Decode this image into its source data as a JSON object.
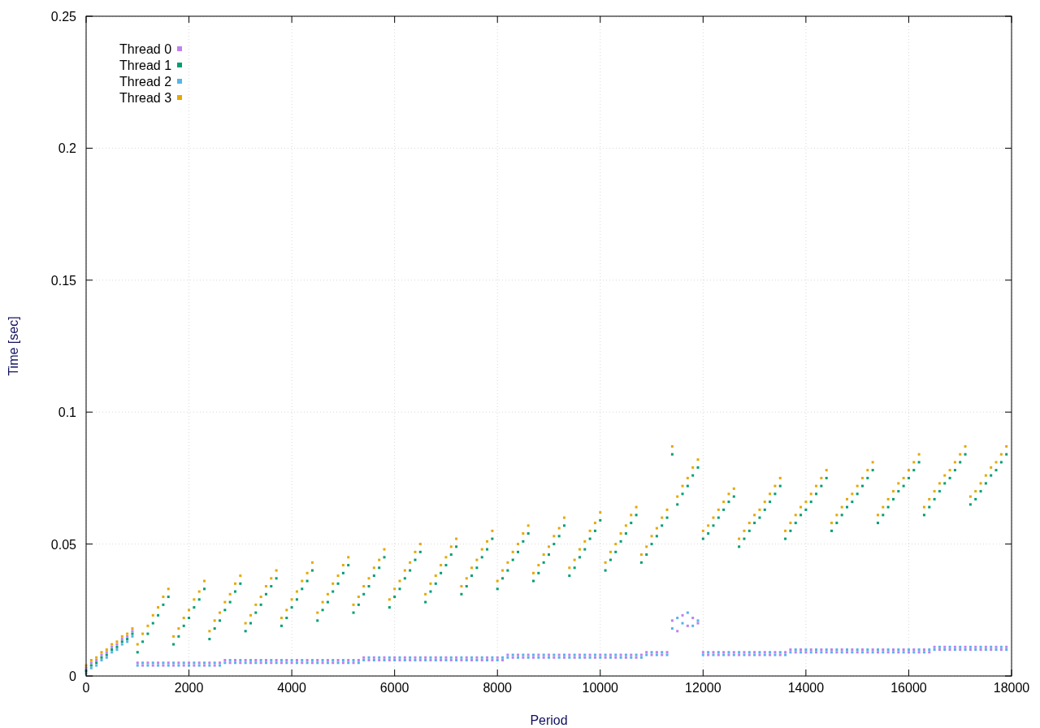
{
  "chart_data": {
    "type": "scatter",
    "xlabel": "Period",
    "ylabel": "Time [sec]",
    "xlim": [
      0,
      18000
    ],
    "ylim": [
      0,
      0.25
    ],
    "grid": true,
    "legend": true,
    "x": [
      0,
      100,
      200,
      300,
      400,
      500,
      600,
      700,
      800,
      900,
      1000,
      1100,
      1200,
      1300,
      1400,
      1500,
      1600,
      1700,
      1800,
      1900,
      2000,
      2100,
      2200,
      2300,
      2400,
      2500,
      2600,
      2700,
      2800,
      2900,
      3000,
      3100,
      3200,
      3300,
      3400,
      3500,
      3600,
      3700,
      3800,
      3900,
      4000,
      4100,
      4200,
      4300,
      4400,
      4500,
      4600,
      4700,
      4800,
      4900,
      5000,
      5100,
      5200,
      5300,
      5400,
      5500,
      5600,
      5700,
      5800,
      5900,
      6000,
      6100,
      6200,
      6300,
      6400,
      6500,
      6600,
      6700,
      6800,
      6900,
      7000,
      7100,
      7200,
      7300,
      7400,
      7500,
      7600,
      7700,
      7800,
      7900,
      8000,
      8100,
      8200,
      8300,
      8400,
      8500,
      8600,
      8700,
      8800,
      8900,
      9000,
      9100,
      9200,
      9300,
      9400,
      9500,
      9600,
      9700,
      9800,
      9900,
      10000,
      10100,
      10200,
      10300,
      10400,
      10500,
      10600,
      10700,
      10800,
      10900,
      11000,
      11100,
      11200,
      11300,
      11400,
      11500,
      11600,
      11700,
      11800,
      11900,
      12000,
      12100,
      12200,
      12300,
      12400,
      12500,
      12600,
      12700,
      12800,
      12900,
      13000,
      13100,
      13200,
      13300,
      13400,
      13500,
      13600,
      13700,
      13800,
      13900,
      14000,
      14100,
      14200,
      14300,
      14400,
      14500,
      14600,
      14700,
      14800,
      14900,
      15000,
      15100,
      15200,
      15300,
      15400,
      15500,
      15600,
      15700,
      15800,
      15900,
      16000,
      16100,
      16200,
      16300,
      16400,
      16500,
      16600,
      16700,
      16800,
      16900,
      17000,
      17100,
      17200,
      17300,
      17400,
      17500,
      17600,
      17700,
      17800,
      17900
    ],
    "xticks": [
      {
        "value": 0,
        "label": "0"
      },
      {
        "value": 2000,
        "label": "2000"
      },
      {
        "value": 4000,
        "label": "4000"
      },
      {
        "value": 6000,
        "label": "6000"
      },
      {
        "value": 8000,
        "label": "8000"
      },
      {
        "value": 10000,
        "label": "10000"
      },
      {
        "value": 12000,
        "label": "12000"
      },
      {
        "value": 14000,
        "label": "14000"
      },
      {
        "value": 16000,
        "label": "16000"
      },
      {
        "value": 18000,
        "label": "18000"
      }
    ],
    "yticks": [
      {
        "value": 0,
        "label": "0"
      },
      {
        "value": 0.05,
        "label": "0.05"
      },
      {
        "value": 0.1,
        "label": "0.1"
      },
      {
        "value": 0.15,
        "label": "0.15"
      },
      {
        "value": 0.2,
        "label": "0.2"
      },
      {
        "value": 0.25,
        "label": "0.25"
      }
    ],
    "series": [
      {
        "name": "Thread 0",
        "color": "#c080f0",
        "values": [
          0.003,
          0.005,
          0.006,
          0.008,
          0.009,
          0.011,
          0.012,
          0.014,
          0.015,
          0.017,
          0.005,
          0.004,
          0.005,
          0.004,
          0.005,
          0.004,
          0.005,
          0.004,
          0.005,
          0.004,
          0.005,
          0.004,
          0.005,
          0.004,
          0.005,
          0.004,
          0.005,
          0.006,
          0.005,
          0.006,
          0.005,
          0.006,
          0.005,
          0.006,
          0.005,
          0.006,
          0.005,
          0.006,
          0.005,
          0.006,
          0.005,
          0.006,
          0.005,
          0.006,
          0.005,
          0.006,
          0.005,
          0.006,
          0.005,
          0.006,
          0.005,
          0.006,
          0.005,
          0.006,
          0.007,
          0.006,
          0.007,
          0.006,
          0.007,
          0.006,
          0.007,
          0.006,
          0.007,
          0.006,
          0.007,
          0.006,
          0.007,
          0.006,
          0.007,
          0.006,
          0.007,
          0.006,
          0.007,
          0.006,
          0.007,
          0.006,
          0.007,
          0.006,
          0.007,
          0.006,
          0.007,
          0.006,
          0.008,
          0.007,
          0.008,
          0.007,
          0.008,
          0.007,
          0.008,
          0.007,
          0.008,
          0.007,
          0.008,
          0.007,
          0.008,
          0.007,
          0.008,
          0.007,
          0.008,
          0.007,
          0.008,
          0.007,
          0.008,
          0.007,
          0.008,
          0.007,
          0.008,
          0.007,
          0.008,
          0.009,
          0.008,
          0.009,
          0.008,
          0.009,
          0.021,
          0.017,
          0.023,
          0.019,
          0.022,
          0.02,
          0.009,
          0.008,
          0.009,
          0.008,
          0.009,
          0.008,
          0.009,
          0.008,
          0.009,
          0.008,
          0.009,
          0.008,
          0.009,
          0.008,
          0.009,
          0.008,
          0.009,
          0.01,
          0.009,
          0.01,
          0.009,
          0.01,
          0.009,
          0.01,
          0.009,
          0.01,
          0.009,
          0.01,
          0.009,
          0.01,
          0.009,
          0.01,
          0.009,
          0.01,
          0.009,
          0.01,
          0.009,
          0.01,
          0.009,
          0.01,
          0.009,
          0.01,
          0.009,
          0.01,
          0.009,
          0.011,
          0.01,
          0.011,
          0.01,
          0.011,
          0.01,
          0.011,
          0.01,
          0.011,
          0.01,
          0.011,
          0.01,
          0.011,
          0.01,
          0.011
        ]
      },
      {
        "name": "Thread 1",
        "color": "#009e73",
        "values": [
          0.002,
          0.004,
          0.005,
          0.007,
          0.008,
          0.01,
          0.011,
          0.013,
          0.014,
          0.016,
          0.009,
          0.013,
          0.016,
          0.02,
          0.023,
          0.027,
          0.03,
          0.012,
          0.015,
          0.019,
          0.022,
          0.026,
          0.029,
          0.033,
          0.014,
          0.018,
          0.021,
          0.025,
          0.028,
          0.032,
          0.035,
          0.017,
          0.02,
          0.024,
          0.027,
          0.031,
          0.034,
          0.037,
          0.019,
          0.022,
          0.026,
          0.029,
          0.033,
          0.036,
          0.04,
          0.021,
          0.025,
          0.028,
          0.032,
          0.035,
          0.039,
          0.042,
          0.024,
          0.027,
          0.031,
          0.034,
          0.038,
          0.041,
          0.045,
          0.026,
          0.03,
          0.033,
          0.037,
          0.04,
          0.044,
          0.047,
          0.028,
          0.032,
          0.035,
          0.039,
          0.042,
          0.046,
          0.049,
          0.031,
          0.034,
          0.038,
          0.041,
          0.045,
          0.048,
          0.052,
          0.033,
          0.037,
          0.04,
          0.044,
          0.047,
          0.051,
          0.054,
          0.036,
          0.039,
          0.043,
          0.046,
          0.05,
          0.053,
          0.057,
          0.038,
          0.041,
          0.045,
          0.048,
          0.052,
          0.055,
          0.059,
          0.04,
          0.044,
          0.047,
          0.051,
          0.054,
          0.058,
          0.061,
          0.043,
          0.046,
          0.05,
          0.053,
          0.057,
          0.06,
          0.084,
          0.065,
          0.069,
          0.072,
          0.076,
          0.079,
          0.052,
          0.054,
          0.057,
          0.06,
          0.063,
          0.066,
          0.068,
          0.049,
          0.052,
          0.055,
          0.058,
          0.06,
          0.063,
          0.066,
          0.069,
          0.072,
          0.052,
          0.055,
          0.058,
          0.061,
          0.063,
          0.066,
          0.069,
          0.072,
          0.075,
          0.055,
          0.058,
          0.061,
          0.064,
          0.066,
          0.069,
          0.072,
          0.075,
          0.078,
          0.058,
          0.061,
          0.064,
          0.067,
          0.07,
          0.072,
          0.075,
          0.078,
          0.081,
          0.061,
          0.064,
          0.067,
          0.07,
          0.073,
          0.075,
          0.078,
          0.081,
          0.084,
          0.065,
          0.067,
          0.07,
          0.073,
          0.076,
          0.078,
          0.081,
          0.084
        ]
      },
      {
        "name": "Thread 2",
        "color": "#56b4e9",
        "values": [
          0.001,
          0.003,
          0.004,
          0.006,
          0.007,
          0.009,
          0.01,
          0.012,
          0.013,
          0.015,
          0.004,
          0.005,
          0.004,
          0.005,
          0.004,
          0.005,
          0.004,
          0.005,
          0.004,
          0.005,
          0.004,
          0.005,
          0.004,
          0.005,
          0.004,
          0.005,
          0.004,
          0.005,
          0.006,
          0.005,
          0.006,
          0.005,
          0.006,
          0.005,
          0.006,
          0.005,
          0.006,
          0.005,
          0.006,
          0.005,
          0.006,
          0.005,
          0.006,
          0.005,
          0.006,
          0.005,
          0.006,
          0.005,
          0.006,
          0.005,
          0.006,
          0.005,
          0.006,
          0.005,
          0.006,
          0.007,
          0.006,
          0.007,
          0.006,
          0.007,
          0.006,
          0.007,
          0.006,
          0.007,
          0.006,
          0.007,
          0.006,
          0.007,
          0.006,
          0.007,
          0.006,
          0.007,
          0.006,
          0.007,
          0.006,
          0.007,
          0.006,
          0.007,
          0.006,
          0.007,
          0.006,
          0.007,
          0.007,
          0.008,
          0.007,
          0.008,
          0.007,
          0.008,
          0.007,
          0.008,
          0.007,
          0.008,
          0.007,
          0.008,
          0.007,
          0.008,
          0.007,
          0.008,
          0.007,
          0.008,
          0.007,
          0.008,
          0.007,
          0.008,
          0.007,
          0.008,
          0.007,
          0.008,
          0.007,
          0.008,
          0.009,
          0.008,
          0.009,
          0.008,
          0.018,
          0.022,
          0.02,
          0.024,
          0.019,
          0.021,
          0.008,
          0.009,
          0.008,
          0.009,
          0.008,
          0.009,
          0.008,
          0.009,
          0.008,
          0.009,
          0.008,
          0.009,
          0.008,
          0.009,
          0.008,
          0.009,
          0.008,
          0.009,
          0.01,
          0.009,
          0.01,
          0.009,
          0.01,
          0.009,
          0.01,
          0.009,
          0.01,
          0.009,
          0.01,
          0.009,
          0.01,
          0.009,
          0.01,
          0.009,
          0.01,
          0.009,
          0.01,
          0.009,
          0.01,
          0.009,
          0.01,
          0.009,
          0.01,
          0.009,
          0.01,
          0.01,
          0.011,
          0.01,
          0.011,
          0.01,
          0.011,
          0.01,
          0.011,
          0.01,
          0.011,
          0.01,
          0.011,
          0.01,
          0.011,
          0.01
        ]
      },
      {
        "name": "Thread 3",
        "color": "#e6a800",
        "values": [
          0.004,
          0.006,
          0.007,
          0.009,
          0.01,
          0.012,
          0.013,
          0.015,
          0.016,
          0.018,
          0.012,
          0.016,
          0.019,
          0.023,
          0.026,
          0.03,
          0.033,
          0.015,
          0.018,
          0.022,
          0.025,
          0.029,
          0.032,
          0.036,
          0.017,
          0.021,
          0.024,
          0.028,
          0.031,
          0.035,
          0.038,
          0.02,
          0.023,
          0.027,
          0.03,
          0.034,
          0.037,
          0.04,
          0.022,
          0.025,
          0.029,
          0.032,
          0.036,
          0.039,
          0.043,
          0.024,
          0.028,
          0.031,
          0.035,
          0.038,
          0.042,
          0.045,
          0.027,
          0.03,
          0.034,
          0.037,
          0.041,
          0.044,
          0.048,
          0.029,
          0.033,
          0.036,
          0.04,
          0.043,
          0.047,
          0.05,
          0.031,
          0.035,
          0.038,
          0.042,
          0.045,
          0.049,
          0.052,
          0.034,
          0.037,
          0.041,
          0.044,
          0.048,
          0.051,
          0.055,
          0.036,
          0.04,
          0.043,
          0.047,
          0.05,
          0.054,
          0.057,
          0.039,
          0.042,
          0.046,
          0.049,
          0.053,
          0.056,
          0.06,
          0.041,
          0.044,
          0.048,
          0.051,
          0.055,
          0.058,
          0.062,
          0.043,
          0.047,
          0.05,
          0.054,
          0.057,
          0.061,
          0.064,
          0.046,
          0.049,
          0.053,
          0.056,
          0.06,
          0.063,
          0.087,
          0.068,
          0.072,
          0.075,
          0.079,
          0.082,
          0.055,
          0.057,
          0.06,
          0.063,
          0.066,
          0.069,
          0.071,
          0.052,
          0.055,
          0.058,
          0.061,
          0.063,
          0.066,
          0.069,
          0.072,
          0.075,
          0.055,
          0.058,
          0.061,
          0.064,
          0.066,
          0.069,
          0.072,
          0.075,
          0.078,
          0.058,
          0.061,
          0.064,
          0.067,
          0.069,
          0.072,
          0.075,
          0.078,
          0.081,
          0.061,
          0.064,
          0.067,
          0.07,
          0.073,
          0.075,
          0.078,
          0.081,
          0.084,
          0.064,
          0.067,
          0.07,
          0.073,
          0.076,
          0.078,
          0.081,
          0.084,
          0.087,
          0.068,
          0.07,
          0.073,
          0.076,
          0.079,
          0.081,
          0.084,
          0.087
        ]
      }
    ]
  }
}
